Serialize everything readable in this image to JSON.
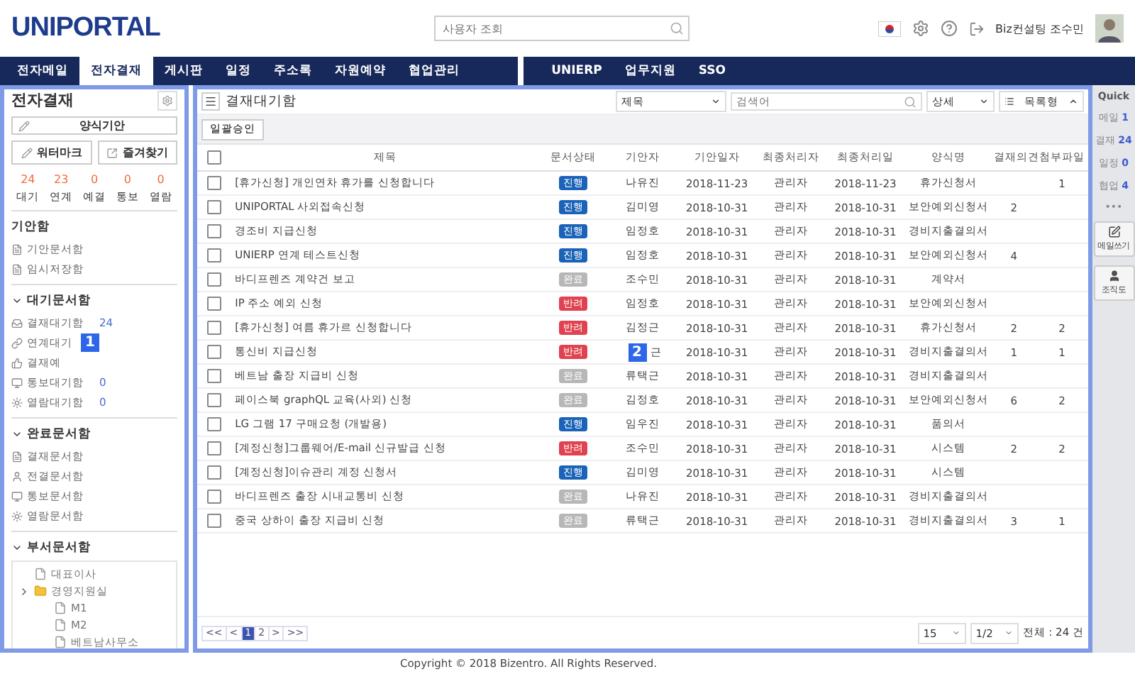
{
  "header": {
    "logo": "UNIPORTAL",
    "search": {
      "placeholder": "사용자 조회"
    },
    "user": "Biz컨설팅 조수민"
  },
  "nav": {
    "left": [
      {
        "label": "전자메일",
        "selected": false
      },
      {
        "label": "전자결재",
        "selected": true
      },
      {
        "label": "게시판",
        "selected": false
      },
      {
        "label": "일정",
        "selected": false
      },
      {
        "label": "주소록",
        "selected": false
      },
      {
        "label": "자원예약",
        "selected": false
      },
      {
        "label": "협업관리",
        "selected": false
      }
    ],
    "right": [
      {
        "label": "UNIERP",
        "selected": false
      },
      {
        "label": "업무지원",
        "selected": false
      },
      {
        "label": "SSO",
        "selected": false
      }
    ]
  },
  "sidebar": {
    "title": "전자결재",
    "draft_button": "양식기안",
    "buttons": [
      "워터마크",
      "즐겨찾기"
    ],
    "counts": [
      {
        "value": "24",
        "label": "대기"
      },
      {
        "value": "23",
        "label": "연계"
      },
      {
        "value": "0",
        "label": "예결"
      },
      {
        "value": "0",
        "label": "통보"
      },
      {
        "value": "0",
        "label": "열람"
      }
    ],
    "sections": [
      {
        "title": "기안함",
        "items": [
          {
            "label": "기안문서함"
          },
          {
            "label": "임시저장함"
          }
        ]
      },
      {
        "title": "대기문서함",
        "expanded": true,
        "items": [
          {
            "label": "결재대기함",
            "count": "24"
          },
          {
            "label": "연계대기",
            "callout": "1"
          },
          {
            "label": "결재예"
          },
          {
            "label": "통보대기함",
            "count": "0"
          },
          {
            "label": "열람대기함",
            "count": "0"
          }
        ]
      },
      {
        "title": "완료문서함",
        "expanded": true,
        "items": [
          {
            "label": "결재문서함"
          },
          {
            "label": "전결문서함"
          },
          {
            "label": "통보문서함"
          },
          {
            "label": "열람문서함"
          }
        ]
      },
      {
        "title": "부서문서함",
        "expanded": true,
        "tree": [
          {
            "label": "대표이사",
            "kind": "document"
          },
          {
            "label": "경영지원실",
            "kind": "folder",
            "children": [
              {
                "label": "M1",
                "kind": "document"
              },
              {
                "label": "M2",
                "kind": "document"
              },
              {
                "label": "베트남사무소",
                "kind": "document"
              }
            ]
          }
        ]
      }
    ]
  },
  "main": {
    "title": "결재대기함",
    "filter": {
      "value": "제목"
    },
    "search": {
      "placeholder": "검색어"
    },
    "detail_button": "상세",
    "view_button": "목록형",
    "bulk_button": "일괄승인",
    "select_all": {
      "checked": false
    },
    "columns": [
      "제목",
      "문서상태",
      "기안자",
      "기안일자",
      "최종처리자",
      "최종처리일",
      "양식명",
      "결재의견",
      "첨부파일"
    ],
    "rows": [
      {
        "checked": false,
        "title": "[휴가신청] 개인연차 휴가를 신청합니다",
        "status": {
          "label": "진행",
          "kind": "progress"
        },
        "drafter": "나유진",
        "draft_date": "2018-11-23",
        "handler": "관리자",
        "handled": "2018-11-23",
        "form": "휴가신청서",
        "attachments": "1"
      },
      {
        "checked": false,
        "title": "UNIPORTAL 사외접속신청",
        "status": {
          "label": "진행",
          "kind": "progress"
        },
        "drafter": "김미영",
        "draft_date": "2018-10-31",
        "handler": "관리자",
        "handled": "2018-10-31",
        "form": "보안예외신청서",
        "comments": "2"
      },
      {
        "checked": false,
        "title": "경조비 지급신청",
        "status": {
          "label": "진행",
          "kind": "progress"
        },
        "drafter": "임정호",
        "draft_date": "2018-10-31",
        "handler": "관리자",
        "handled": "2018-10-31",
        "form": "경비지출결의서"
      },
      {
        "checked": false,
        "title": "UNIERP 연계 테스트신청",
        "status": {
          "label": "진행",
          "kind": "progress"
        },
        "drafter": "임정호",
        "draft_date": "2018-10-31",
        "handler": "관리자",
        "handled": "2018-10-31",
        "form": "보안예외신청서",
        "comments": "4"
      },
      {
        "checked": false,
        "title": "바디프렌즈 계약건 보고",
        "status": {
          "label": "완료",
          "kind": "done"
        },
        "drafter": "조수민",
        "draft_date": "2018-10-31",
        "handler": "관리자",
        "handled": "2018-10-31",
        "form": "계약서"
      },
      {
        "checked": false,
        "title": "IP 주소 예외 신청",
        "status": {
          "label": "반려",
          "kind": "rejected"
        },
        "drafter": "임정호",
        "draft_date": "2018-10-31",
        "handler": "관리자",
        "handled": "2018-10-31",
        "form": "보안예외신청서"
      },
      {
        "checked": false,
        "title": "[휴가신청] 여름 휴가르 신청합니다",
        "status": {
          "label": "반려",
          "kind": "rejected"
        },
        "drafter": "김정근",
        "draft_date": "2018-10-31",
        "handler": "관리자",
        "handled": "2018-10-31",
        "form": "휴가신청서",
        "comments": "2",
        "attachments": "2"
      },
      {
        "checked": false,
        "title": "통신비 지급신청",
        "status": {
          "label": "반려",
          "kind": "rejected"
        },
        "callout": "2",
        "drafter": "근",
        "draft_date": "2018-10-31",
        "handler": "관리자",
        "handled": "2018-10-31",
        "form": "경비지출결의서",
        "comments": "1",
        "attachments": "1"
      },
      {
        "checked": false,
        "title": "베트남 출장 지급비 신청",
        "status": {
          "label": "완료",
          "kind": "done"
        },
        "drafter": "류택근",
        "draft_date": "2018-10-31",
        "handler": "관리자",
        "handled": "2018-10-31",
        "form": "경비지출결의서"
      },
      {
        "checked": false,
        "title": "페이스북 graphQL 교육(사외) 신청",
        "status": {
          "label": "완료",
          "kind": "done"
        },
        "drafter": "김정호",
        "draft_date": "2018-10-31",
        "handler": "관리자",
        "handled": "2018-10-31",
        "form": "보안예외신청서",
        "comments": "6",
        "attachments": "2"
      },
      {
        "checked": false,
        "title": "LG 그램 17 구매요청 (개발용)",
        "status": {
          "label": "진행",
          "kind": "progress"
        },
        "drafter": "임우진",
        "draft_date": "2018-10-31",
        "handler": "관리자",
        "handled": "2018-10-31",
        "form": "품의서"
      },
      {
        "checked": false,
        "title": "[계정신청]그룹웨어/E-mail 신규발급 신청",
        "status": {
          "label": "반려",
          "kind": "rejected"
        },
        "drafter": "조수민",
        "draft_date": "2018-10-31",
        "handler": "관리자",
        "handled": "2018-10-31",
        "form": "시스템",
        "comments": "2",
        "attachments": "2"
      },
      {
        "checked": false,
        "title": "[계정신청]이슈관리 계정 신청서",
        "status": {
          "label": "진행",
          "kind": "progress"
        },
        "drafter": "김미영",
        "draft_date": "2018-10-31",
        "handler": "관리자",
        "handled": "2018-10-31",
        "form": "시스템"
      },
      {
        "checked": false,
        "title": "바디프렌즈 출장 시내교통비 신청",
        "status": {
          "label": "완료",
          "kind": "done"
        },
        "drafter": "나유진",
        "draft_date": "2018-10-31",
        "handler": "관리자",
        "handled": "2018-10-31",
        "form": "경비지출결의서"
      },
      {
        "checked": false,
        "title": "중국 상하이 출장 지급비 신청",
        "status": {
          "label": "완료",
          "kind": "done"
        },
        "drafter": "류택근",
        "draft_date": "2018-10-31",
        "handler": "관리자",
        "handled": "2018-10-31",
        "form": "경비지출결의서",
        "comments": "3",
        "attachments": "1"
      }
    ],
    "pagination": {
      "first": "<<",
      "prev": "<",
      "pages": [
        {
          "label": "1",
          "selected": true
        },
        {
          "label": "2",
          "selected": false
        }
      ],
      "next": ">",
      "last": ">>",
      "page_size": "15",
      "page_of": "1/2",
      "total": "전체 : 24 건"
    }
  },
  "quick": {
    "title": "Quick",
    "items": [
      {
        "label": "메일",
        "count": "1"
      },
      {
        "label": "결재",
        "count": "24"
      },
      {
        "label": "일정",
        "count": "0"
      },
      {
        "label": "협업",
        "count": "4"
      }
    ],
    "more": "•••",
    "buttons": [
      "메일쓰기",
      "조직도"
    ]
  },
  "footer": "Copyright © 2018 Bizentro. All Rights Reserved."
}
